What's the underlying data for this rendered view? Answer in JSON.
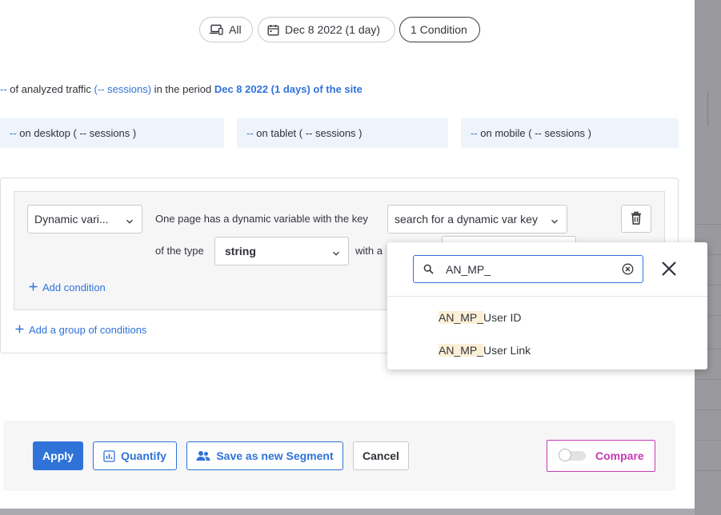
{
  "filters": {
    "device_label": "All",
    "date_label": "Dec 8 2022 (1 day)",
    "conditions_label": "1 Condition"
  },
  "traffic_info": {
    "placeholder": "--",
    "text1": " of analyzed traffic ",
    "sessions": "(-- sessions)",
    "text2": " in the period ",
    "period": "Dec 8 2022 (1 days) of the site"
  },
  "device_stats": [
    {
      "value": "--",
      "label": " on desktop ( -- sessions )"
    },
    {
      "value": "--",
      "label": " on tablet ( -- sessions )"
    },
    {
      "value": "--",
      "label": " on mobile ( -- sessions )"
    }
  ],
  "condition": {
    "type_select": "Dynamic vari...",
    "sentence_part1": "One page has a dynamic variable with the key",
    "key_select": "search for a dynamic var key",
    "sentence_part2": "of the type",
    "value_type": "string",
    "sentence_part3": "with a",
    "add_condition": "Add condition",
    "add_group": "Add a group of conditions"
  },
  "key_dropdown": {
    "search_value": "AN_MP_",
    "options": [
      {
        "match": "AN_MP_",
        "rest": "User ID"
      },
      {
        "match": "AN_MP_",
        "rest": "User Link"
      }
    ]
  },
  "footer": {
    "apply": "Apply",
    "quantify": "Quantify",
    "save_segment": "Save as new Segment",
    "cancel": "Cancel",
    "compare": "Compare"
  },
  "colors": {
    "accent": "#2f73d9",
    "compare": "#c43bb2",
    "highlight": "#fbf0d7"
  }
}
